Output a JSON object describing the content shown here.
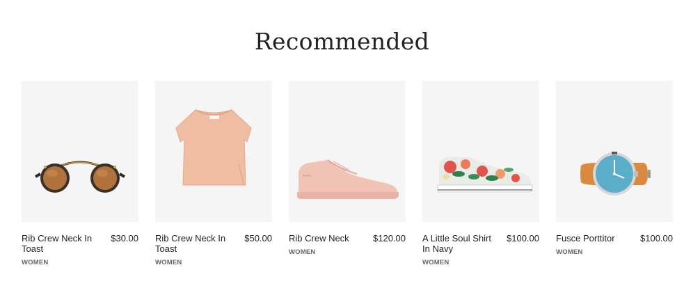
{
  "section": {
    "title": "Recommended"
  },
  "products": [
    {
      "name": "Rib Crew Neck In Toast",
      "price": "$30.00",
      "category": "WOMEN",
      "icon": "sunglasses-image"
    },
    {
      "name": "Rib Crew Neck In Toast",
      "price": "$50.00",
      "category": "WOMEN",
      "icon": "pink-top-image"
    },
    {
      "name": "Rib Crew Neck",
      "price": "$120.00",
      "category": "WOMEN",
      "icon": "pink-sneaker-image"
    },
    {
      "name": "A Little Soul Shirt In Navy",
      "price": "$100.00",
      "category": "WOMEN",
      "icon": "floral-sneaker-image"
    },
    {
      "name": "Fusce Porttitor",
      "price": "$100.00",
      "category": "WOMEN",
      "icon": "wristwatch-image"
    }
  ],
  "colors": {
    "image_bg": "#f5f5f5",
    "text": "#222222",
    "category_text": "#666666"
  }
}
